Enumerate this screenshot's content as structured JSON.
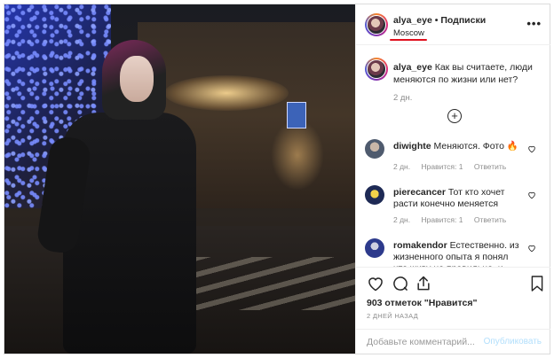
{
  "post": {
    "username": "alya_eye",
    "separator": "•",
    "follow_label": "Подписки",
    "location": "Moscow",
    "more_label": "•••"
  },
  "caption": {
    "username": "alya_eye",
    "text": "Как вы считаете, люди меняются по жизни или нет?",
    "age": "2 дн.",
    "load_more_label": "+"
  },
  "comments": [
    {
      "username": "diwighte",
      "text": "Меняются. Фото 🔥",
      "age": "2 дн.",
      "likes": "Нравится: 1",
      "reply": "Ответить"
    },
    {
      "username": "pierecancer",
      "text": "Тот кто хочет расти конечно меняется",
      "age": "2 дн.",
      "likes": "Нравится: 1",
      "reply": "Ответить"
    },
    {
      "username": "romakendor",
      "text": "Естественно. из жизненного опыта я понял что живу не правильно, и решил",
      "age": "",
      "likes": "",
      "reply": ""
    }
  ],
  "actions": {
    "likes_text": "903 отметок \"Нравится\"",
    "time_ago": "2 ДНЕЙ НАЗАД"
  },
  "add_comment": {
    "placeholder": "Добавьте комментарий...",
    "publish_label": "Опубликовать"
  },
  "colors": {
    "text": "#262626",
    "muted": "#8e8e8e",
    "publish_disabled": "#b2dffc",
    "location_underline": "#e0101e"
  },
  "icons": [
    "heart-icon",
    "comment-icon",
    "share-icon",
    "bookmark-icon",
    "plus-circle-icon",
    "more-icon"
  ]
}
